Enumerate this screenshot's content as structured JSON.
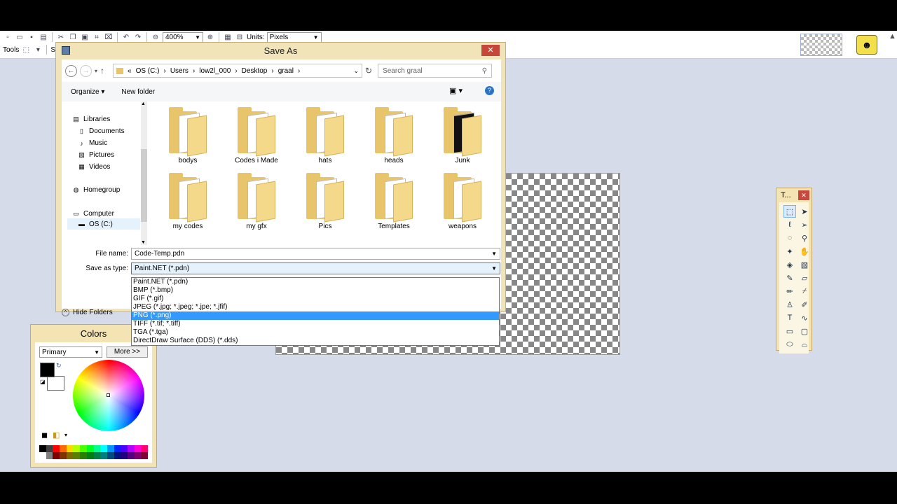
{
  "app": {
    "zoom_value": "400%",
    "units_label": "Units:",
    "units_value": "Pixels",
    "tools_label": "Tools",
    "select_label": "Sel"
  },
  "dialog": {
    "title": "Save As",
    "address": [
      "OS (C:)",
      "Users",
      "low2l_000",
      "Desktop",
      "graal"
    ],
    "search_placeholder": "Search graal",
    "organize_label": "Organize",
    "new_folder_label": "New folder",
    "nav": {
      "libraries": "Libraries",
      "documents": "Documents",
      "music": "Music",
      "pictures": "Pictures",
      "videos": "Videos",
      "homegroup": "Homegroup",
      "computer": "Computer",
      "os_c": "OS (C:)"
    },
    "folders": [
      "bodys",
      "Codes i Made",
      "hats",
      "heads",
      "Junk",
      "my codes",
      "my gfx",
      "Pics",
      "Templates",
      "weapons"
    ],
    "file_name_label": "File name:",
    "file_name_value": "Code-Temp.pdn",
    "save_type_label": "Save as type:",
    "save_type_value": "Paint.NET (*.pdn)",
    "hide_folders_label": "Hide Folders",
    "type_options": [
      "Paint.NET (*.pdn)",
      "BMP (*.bmp)",
      "GIF (*.gif)",
      "JPEG (*.jpg; *.jpeg; *.jpe; *.jfif)",
      "PNG (*.png)",
      "TIFF (*.tif; *.tiff)",
      "TGA (*.tga)",
      "DirectDraw Surface (DDS) (*.dds)"
    ],
    "highlighted_option": "PNG (*.png)"
  },
  "colors_window": {
    "title": "Colors",
    "mode_value": "Primary",
    "more_label": "More >>",
    "primary_color": "#000000",
    "secondary_color": "#ffffff",
    "palette_top": [
      "#000000",
      "#404040",
      "#ff0000",
      "#ff6a00",
      "#ffd800",
      "#b6ff00",
      "#4cff00",
      "#00ff21",
      "#00ff90",
      "#00ffff",
      "#0094ff",
      "#0026ff",
      "#4800ff",
      "#b200ff",
      "#ff00dc",
      "#ff006e"
    ],
    "palette_bottom": [
      "#ffffff",
      "#808080",
      "#7f0000",
      "#7f3300",
      "#7f6a00",
      "#5b7f00",
      "#267f00",
      "#007f0e",
      "#007f46",
      "#007f7f",
      "#004a7f",
      "#00137f",
      "#21007f",
      "#57007f",
      "#7f006e",
      "#7f0037"
    ]
  },
  "tools_window": {
    "title": "T...",
    "tools": [
      "rectangle-select",
      "move-selection",
      "lasso-select",
      "move-selection-outline",
      "ellipse-select",
      "zoom",
      "magic-wand",
      "pan",
      "paint-bucket",
      "gradient",
      "paintbrush",
      "eraser",
      "pencil",
      "color-picker",
      "clone-stamp",
      "recolor",
      "text",
      "line-curve",
      "rectangle",
      "rounded-rectangle",
      "ellipse",
      "freeform-shape"
    ]
  }
}
